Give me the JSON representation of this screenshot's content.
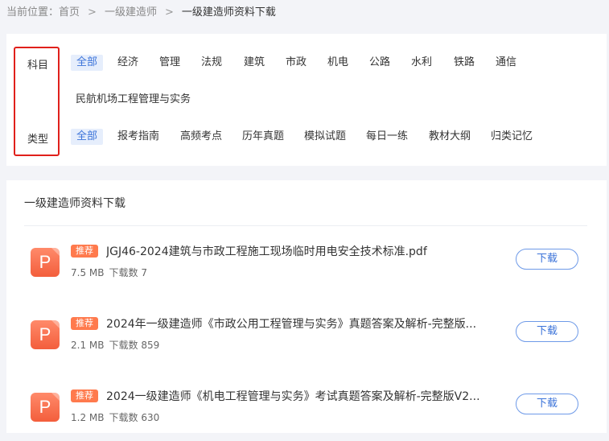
{
  "breadcrumb": {
    "prefix": "当前位置：",
    "home": "首页",
    "sep1": ">",
    "category": "一级建造师",
    "sep2": ">",
    "current": "一级建造师资料下载"
  },
  "filters": {
    "subject": {
      "label": "科目",
      "options": [
        "全部",
        "经济",
        "管理",
        "法规",
        "建筑",
        "市政",
        "机电",
        "公路",
        "水利",
        "铁路",
        "通信",
        "民航机场工程管理与实务"
      ],
      "selected": "全部"
    },
    "type": {
      "label": "类型",
      "options": [
        "全部",
        "报考指南",
        "高频考点",
        "历年真题",
        "模拟试题",
        "每日一练",
        "教材大纲",
        "归类记忆"
      ],
      "selected": "全部"
    }
  },
  "list": {
    "title": "一级建造师资料下载",
    "items": [
      {
        "icon_letter": "P",
        "badge": "推荐",
        "name": "JGJ46-2024建筑与市政工程施工现场临时用电安全技术标准.pdf",
        "size": "7.5 MB",
        "count_label": "下载数",
        "count": "7",
        "button": "下载"
      },
      {
        "icon_letter": "P",
        "badge": "推荐",
        "name": "2024年一级建造师《市政公用工程管理与实务》真题答案及解析-完整版...",
        "size": "2.1 MB",
        "count_label": "下载数",
        "count": "859",
        "button": "下载"
      },
      {
        "icon_letter": "P",
        "badge": "推荐",
        "name": "2024一级建造师《机电工程管理与实务》考试真题答案及解析-完整版V2...",
        "size": "1.2 MB",
        "count_label": "下载数",
        "count": "630",
        "button": "下载"
      }
    ]
  },
  "colors": {
    "accent": "#3b73d9",
    "highlight_border": "#e0201b",
    "badge": "#ff7a4d",
    "pdf_icon": "#f35e3c"
  }
}
